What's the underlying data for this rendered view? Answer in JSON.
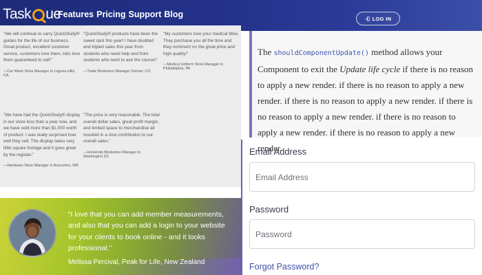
{
  "header": {
    "logo_prefix": "Task",
    "logo_suffix": "ue",
    "nav": [
      "Features",
      "Pricing",
      "Support",
      "Blog"
    ],
    "login_label": "LOG IN"
  },
  "testimonials": [
    {
      "quote": "\"We will continue to carry QuickStudy® guides for the life of our business. Great product, excellent customer service, customers love them, kids love them guaranteed to sell!\"",
      "author": "—Car Wash Store Manager in Laguna Hills, CA"
    },
    {
      "quote": "\"QuickStudy® products have been the sweet spot this year! I have doubled and tripled sales this year from students who need help and from students who want to ace the course!\"",
      "author": "—Trade Bookstore Manager Denver, CO"
    },
    {
      "quote": "\"My customers love your medical titles. They purchase you all the time and they comment on the great price and high quality!\"",
      "author": "—Medical Uniform Store Manager in Philadelphia, PA"
    },
    {
      "quote": "\"We have had the QuickStudy® display in our store less than a year now, and we have sold more than $1,000 worth of product. I was really surprised how well they sell. The display takes very little square footage and it goes great by the register.\"",
      "author": "—Hardware Store Manager in Anacortes, WA"
    },
    {
      "quote": "\"The price is very reasonable. The total overall dollar sales, great profit margin, and limited space to merchandise all resulted in a nice contribution to our overall sales.\"",
      "author": "—University Bookstore Manager in Washington DC"
    }
  ],
  "banner": {
    "quote": "“I love that you can add member measurements, and also that you can add a login to your website for your clients to book online - and it looks professional.”",
    "author": "Melissa Percival, Peak for Life, New Zealand"
  },
  "doc": {
    "intro": "The ",
    "method": "shouldComponentUpdate()",
    "mid": " method allows your Component to exit the ",
    "cycle": "Update life cycle",
    "rest": " if there is no reason to apply a new render. if there is no reason to apply a new render. if there is no reason to apply a new render. if there is no reason to apply a new render. if there is no reason to apply a new render. if there is no reason to apply a new render."
  },
  "form": {
    "email_label": "Email Address",
    "email_placeholder": "Email Address",
    "password_label": "Password",
    "password_placeholder": "Password",
    "forgot": "Forgot Password?"
  },
  "icons": {
    "login": "login-arrow-icon",
    "logo_mark": "q-ring-icon"
  },
  "colors": {
    "nav_bg": "#23318a",
    "logo_accent": "#f3a21b",
    "doc_border": "#7e70c2",
    "method_code": "#3e52b0",
    "link": "#3f4fa7"
  }
}
